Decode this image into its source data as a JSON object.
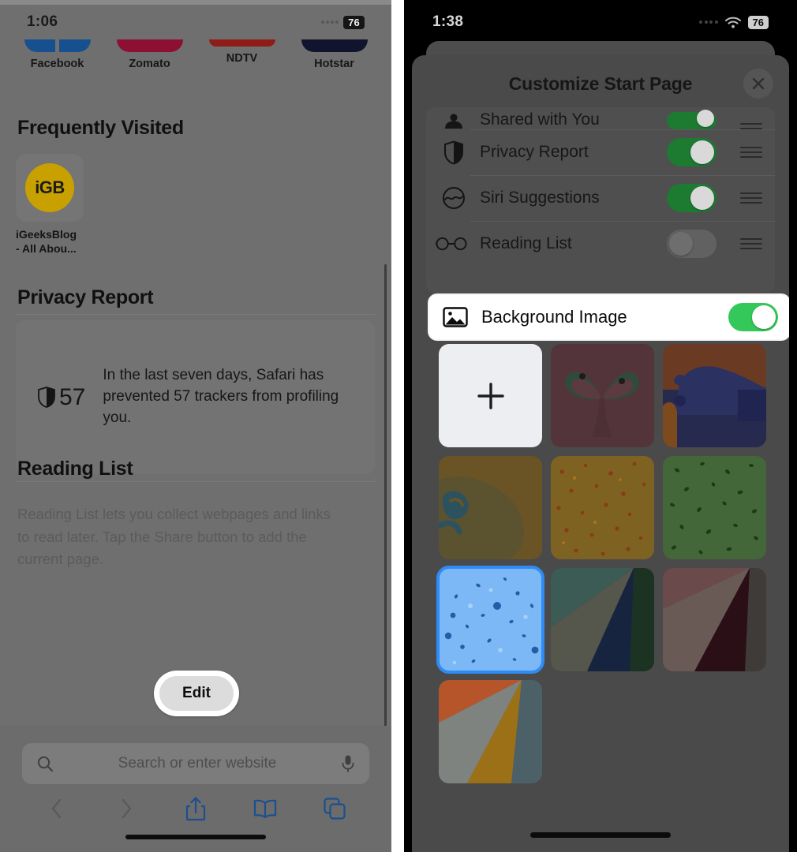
{
  "left_phone": {
    "status_bar": {
      "time": "1:06",
      "battery": "76",
      "signal_icon": "signal-dots-icon"
    },
    "favorites": [
      {
        "label": "Facebook",
        "color": "#17508f",
        "icon": "facebook-favicon"
      },
      {
        "label": "Zomato",
        "color": "#8d1034",
        "icon": "zomato-favicon"
      },
      {
        "label": "NDTV",
        "color": "#8e1d18",
        "icon": "ndtv-favicon"
      },
      {
        "label": "Hotstar",
        "color": "#10142c",
        "icon": "hotstar-favicon"
      }
    ],
    "frequently_visited": {
      "title": "Frequently Visited",
      "items": [
        {
          "badge": "iGB",
          "badge_color": "#c8a000",
          "name": "iGeeksBlog\n- All Abou..."
        }
      ]
    },
    "privacy_report": {
      "title": "Privacy Report",
      "count": "57",
      "shield_icon": "shield-icon",
      "text": "In the last seven days, Safari has prevented 57 trackers from profiling you."
    },
    "reading_list": {
      "title": "Reading List",
      "body": "Reading List lets you collect webpages and links to read later. Tap the Share button to add the current page.",
      "edit_label": "Edit"
    },
    "bottom_bar": {
      "search_placeholder": "Search or enter website",
      "search_icon": "search-icon",
      "mic_icon": "microphone-icon",
      "back_icon": "chevron-left-icon",
      "forward_icon": "chevron-right-icon",
      "share_icon": "share-icon",
      "bookmarks_icon": "book-icon",
      "tabs_icon": "tabs-icon"
    }
  },
  "right_phone": {
    "status_bar": {
      "time": "1:38",
      "battery": "76",
      "wifi_icon": "wifi-icon",
      "signal_icon": "signal-dots-icon"
    },
    "sheet": {
      "title": "Customize Start Page",
      "close_icon": "close-icon",
      "rows": [
        {
          "label": "Shared with You",
          "icon": "shared-with-you-icon",
          "toggle": "on",
          "reorder_icon": "reorder-handle-icon",
          "clipped": true
        },
        {
          "label": "Privacy Report",
          "icon": "shield-icon",
          "toggle": "on",
          "reorder_icon": "reorder-handle-icon"
        },
        {
          "label": "Siri Suggestions",
          "icon": "siri-icon",
          "toggle": "on",
          "reorder_icon": "reorder-handle-icon"
        },
        {
          "label": "Reading List",
          "icon": "glasses-icon",
          "toggle": "off",
          "reorder_icon": "reorder-handle-icon"
        }
      ],
      "background_image_row": {
        "label": "Background Image",
        "icon": "photo-icon",
        "toggle": "on",
        "highlighted": true
      },
      "wallpapers": [
        {
          "name": "add-custom",
          "type": "add",
          "plus_icon": "plus-icon",
          "selected": false
        },
        {
          "name": "butterfly",
          "type": "image",
          "colors": [
            "#4f3338",
            "#2f4438"
          ],
          "selected": false
        },
        {
          "name": "bear",
          "type": "image",
          "colors": [
            "#6b3a22",
            "#2a2f55"
          ],
          "selected": false
        },
        {
          "name": "wave",
          "type": "image",
          "colors": [
            "#6a5426",
            "#2c4a4a"
          ],
          "selected": false
        },
        {
          "name": "autumn-dots",
          "type": "pattern",
          "colors": [
            "#7d6222",
            "#8a3a16"
          ],
          "selected": false
        },
        {
          "name": "green-leaves",
          "type": "pattern",
          "colors": [
            "#3e6130",
            "#1d3a16"
          ],
          "selected": false
        },
        {
          "name": "blue-confetti",
          "type": "pattern",
          "colors": [
            "#7cb8f5",
            "#1f5fa8"
          ],
          "selected": true
        },
        {
          "name": "teal-fold",
          "type": "gradient",
          "colors": [
            "#3c5b54",
            "#16243f",
            "#1c3323"
          ],
          "selected": false
        },
        {
          "name": "maroon-fold",
          "type": "gradient",
          "colors": [
            "#6b4a4c",
            "#2a0f16",
            "#3e3b39"
          ],
          "selected": false
        },
        {
          "name": "orange-fold",
          "type": "gradient",
          "colors": [
            "#b6552a",
            "#9c7016",
            "#4c6068"
          ],
          "selected": false
        }
      ]
    }
  }
}
